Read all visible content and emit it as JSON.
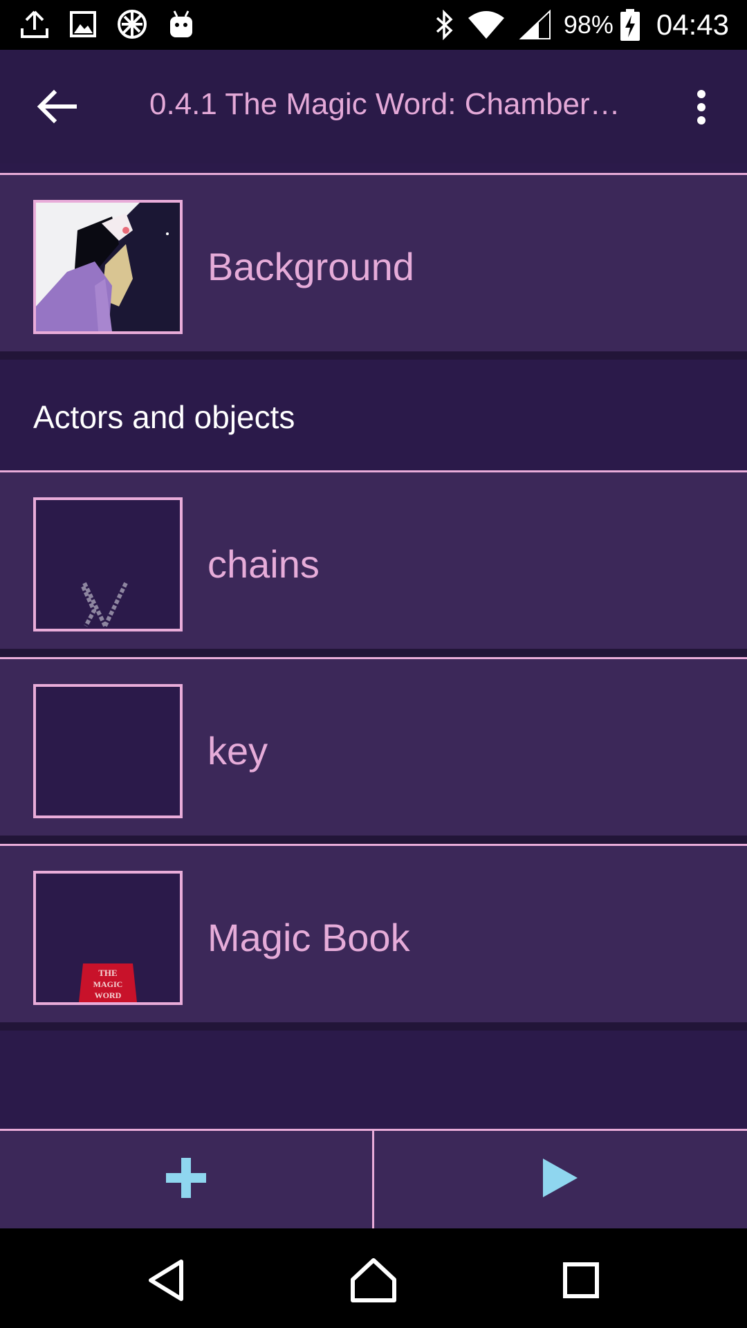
{
  "status_bar": {
    "battery_percent": "98%",
    "time": "04:43",
    "icons_left": [
      "upload-icon",
      "image-icon",
      "network-blocked-icon",
      "android-debug-icon"
    ],
    "icons_right": [
      "bluetooth-icon",
      "wifi-icon",
      "cell-signal-icon",
      "battery-charging-icon"
    ]
  },
  "toolbar": {
    "title": "0.4.1 The Magic Word: Chamber…",
    "back_icon": "arrow-left-icon",
    "menu_icon": "more-vert-icon"
  },
  "background_row": {
    "label": "Background"
  },
  "section": {
    "title": "Actors and objects"
  },
  "objects": [
    {
      "label": "chains"
    },
    {
      "label": "key"
    },
    {
      "label": "Magic Book"
    }
  ],
  "magic_book_logo": {
    "line1": "THE",
    "line2": "MAGIC",
    "line3": "WORD"
  },
  "bottom_bar": {
    "add_icon": "plus-icon",
    "play_icon": "play-icon"
  },
  "nav_bar": {
    "icons": [
      "back-triangle-icon",
      "home-icon",
      "recents-icon"
    ]
  },
  "colors": {
    "accent_pink": "#e9acd9",
    "toolbar_bg": "#2a1a48",
    "row_bg": "#3c2859",
    "action_icon": "#8fd6ef"
  }
}
